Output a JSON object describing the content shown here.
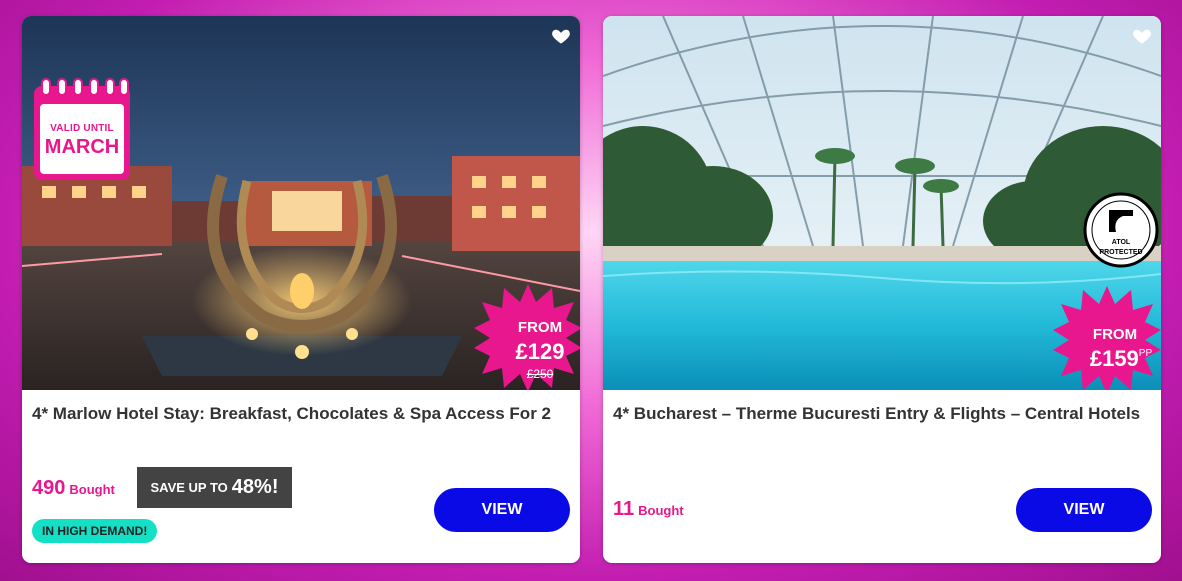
{
  "cards": [
    {
      "badge_line1": "VALID UNTIL",
      "badge_line2": "MARCH",
      "from_label": "FROM",
      "price": "£129",
      "was_price": "£250",
      "title": "4* Marlow Hotel Stay: Breakfast, Chocolates & Spa Access For 2",
      "bought_count": "490",
      "bought_label": "Bought",
      "save_prefix": "SAVE UP TO",
      "save_value": "48%!",
      "demand_label": "IN HIGH DEMAND!",
      "view_label": "VIEW"
    },
    {
      "from_label": "FROM",
      "price": "£159",
      "price_suffix": "PP",
      "atol_text1": "ATOL",
      "atol_text2": "PROTECTED",
      "title": "4* Bucharest – Therme Bucuresti Entry & Flights – Central Hotels",
      "bought_count": "11",
      "bought_label": "Bought",
      "view_label": "VIEW"
    }
  ],
  "colors": {
    "brand_pink": "#e8178d",
    "view_button": "#0a0ae6",
    "demand_badge": "#14e0c6",
    "save_badge": "#434343"
  },
  "icons": [
    "heart-icon",
    "calendar-badge-icon",
    "starburst-icon",
    "atol-icon"
  ]
}
